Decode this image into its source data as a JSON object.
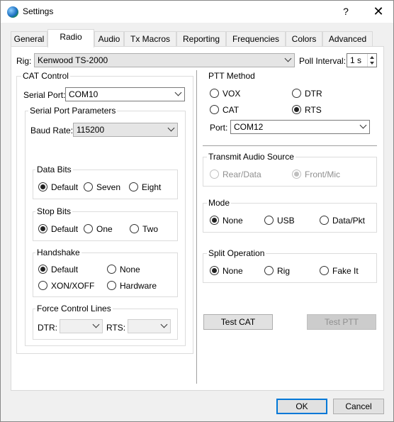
{
  "window": {
    "title": "Settings",
    "help": "?",
    "close": "✕"
  },
  "tabs": [
    "General",
    "Radio",
    "Audio",
    "Tx Macros",
    "Reporting",
    "Frequencies",
    "Colors",
    "Advanced"
  ],
  "active_tab": "Radio",
  "rig": {
    "label": "Rig:",
    "value": "Kenwood TS-2000"
  },
  "poll": {
    "label": "Poll Interval:",
    "value": "1 s"
  },
  "cat": {
    "title": "CAT Control",
    "serial_port_label": "Serial Port:",
    "serial_port_value": "COM10",
    "params_title": "Serial Port Parameters",
    "baud_label": "Baud Rate:",
    "baud_value": "115200",
    "data_bits": {
      "title": "Data Bits",
      "options": [
        "Default",
        "Seven",
        "Eight"
      ],
      "selected": "Default"
    },
    "stop_bits": {
      "title": "Stop Bits",
      "options": [
        "Default",
        "One",
        "Two"
      ],
      "selected": "Default"
    },
    "handshake": {
      "title": "Handshake",
      "options": [
        "Default",
        "None",
        "XON/XOFF",
        "Hardware"
      ],
      "selected": "Default"
    },
    "force": {
      "title": "Force Control Lines",
      "dtr_label": "DTR:",
      "rts_label": "RTS:"
    }
  },
  "ptt": {
    "title": "PTT Method",
    "options": [
      "VOX",
      "DTR",
      "CAT",
      "RTS"
    ],
    "selected": "RTS",
    "port_label": "Port:",
    "port_value": "COM12"
  },
  "tx_audio": {
    "title": "Transmit Audio Source",
    "options": [
      "Rear/Data",
      "Front/Mic"
    ],
    "selected": "Front/Mic"
  },
  "mode": {
    "title": "Mode",
    "options": [
      "None",
      "USB",
      "Data/Pkt"
    ],
    "selected": "None"
  },
  "split": {
    "title": "Split Operation",
    "options": [
      "None",
      "Rig",
      "Fake It"
    ],
    "selected": "None"
  },
  "buttons": {
    "test_cat": "Test CAT",
    "test_ptt": "Test PTT",
    "ok": "OK",
    "cancel": "Cancel"
  }
}
